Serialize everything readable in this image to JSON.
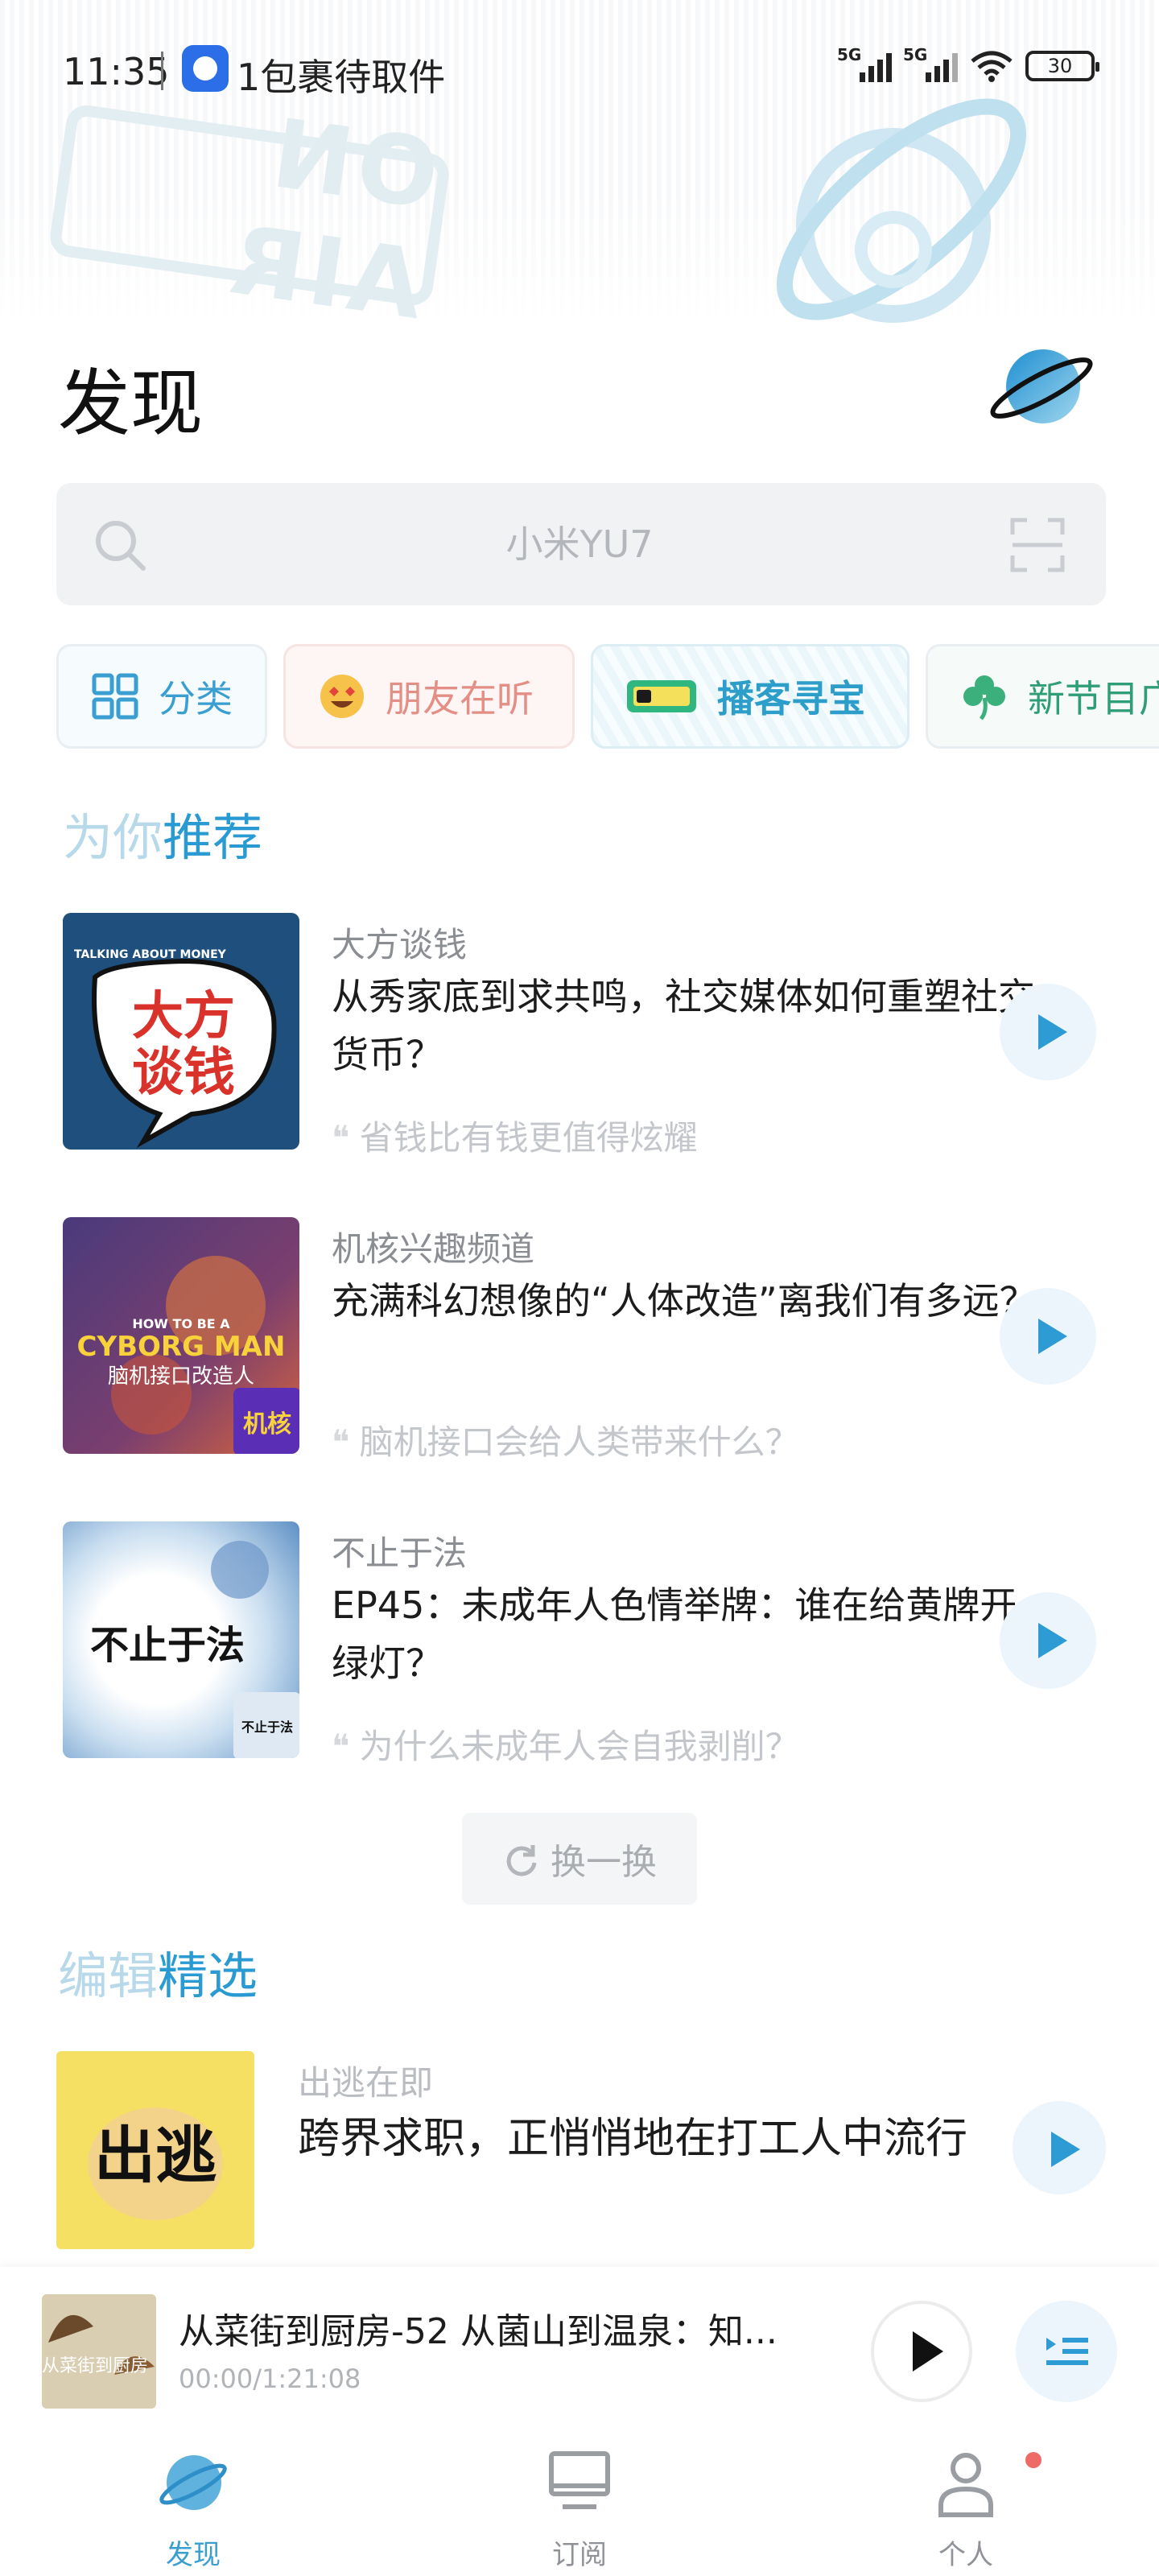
{
  "status_bar": {
    "time": "11:35",
    "notification_text": "1包裹待取件",
    "network_1": "5G",
    "network_2": "5G",
    "battery": "30"
  },
  "header": {
    "title": "发现",
    "onair_art_text": "ON AIR"
  },
  "search": {
    "placeholder": "小米YU7"
  },
  "chips": [
    {
      "label": "分类",
      "icon": "grid-icon"
    },
    {
      "label": "朋友在听",
      "icon": "heart-eyes-emoji-icon"
    },
    {
      "label": "播客寻宝",
      "icon": "treasure-ticket-icon"
    },
    {
      "label": "新节目广",
      "icon": "clover-icon"
    }
  ],
  "recommend": {
    "title_a": "为你",
    "title_b": "推荐",
    "items": [
      {
        "source": "大方谈钱",
        "title": "从秀家底到求共鸣，社交媒体如何重塑社交货币？",
        "quote": "省钱比有钱更值得炫耀",
        "cover_text": "大方谈钱",
        "cover_sub": "TALKING ABOUT MONEY"
      },
      {
        "source": "机核兴趣频道",
        "title": "充满科幻想像的“人体改造”离我们有多远？",
        "quote": "脑机接口会给人类带来什么？",
        "cover_text": "CYBORG MAN",
        "cover_top": "HOW TO BE A",
        "cover_sub": "脑机接口改造人",
        "cover_badge": "机核"
      },
      {
        "source": "不止于法",
        "title": "EP45：未成年人色情举牌：谁在给黄牌开绿灯？",
        "quote": "为什么未成年人会自我剥削？",
        "cover_text": "不止于法",
        "cover_badge": "不止于法"
      }
    ],
    "refresh_label": "换一换"
  },
  "editor_pick": {
    "title_a": "编辑",
    "title_b": "精选",
    "item": {
      "source": "出逃在即",
      "title": "跨界求职，正悄悄地在打工人中流行",
      "cover_text": "出逃"
    }
  },
  "player": {
    "title": "从菜街到厨房-52 从菌山到温泉：知...",
    "time": "00:00/1:21:08",
    "cover_text": "从菜街到厨房"
  },
  "tabs": [
    {
      "label": "发现",
      "icon": "planet-icon"
    },
    {
      "label": "订阅",
      "icon": "monitor-icon"
    },
    {
      "label": "个人",
      "icon": "person-icon"
    }
  ],
  "colors": {
    "accent": "#2a9ad3",
    "accent_light": "#b7d9ea",
    "play_bg": "#ebf5fb",
    "badge_red": "#ef6b67"
  }
}
